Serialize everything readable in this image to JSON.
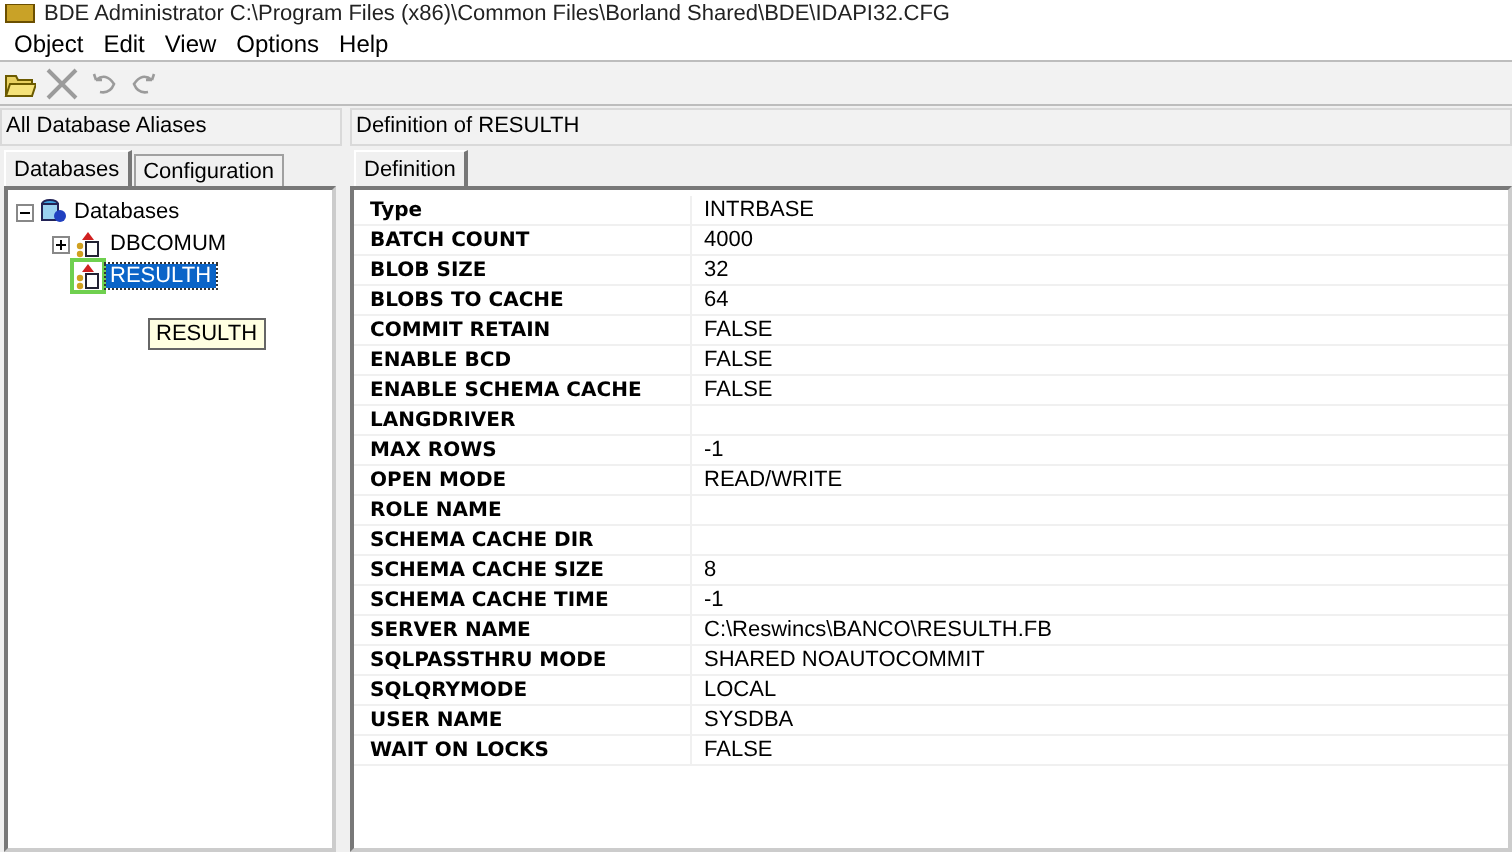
{
  "window": {
    "title": "BDE Administrator  C:\\Program Files (x86)\\Common Files\\Borland Shared\\BDE\\IDAPI32.CFG"
  },
  "menu": [
    "Object",
    "Edit",
    "View",
    "Options",
    "Help"
  ],
  "toolbar": [
    {
      "kind": "open",
      "disabled": false
    },
    {
      "kind": "delete",
      "disabled": true
    },
    {
      "kind": "undo",
      "disabled": true
    },
    {
      "kind": "redo",
      "disabled": true
    }
  ],
  "left": {
    "header": "All Database Aliases",
    "tabs": [
      {
        "label": "Databases",
        "selected": true
      },
      {
        "label": "Configuration",
        "selected": false
      }
    ],
    "tree": [
      {
        "label": "Databases",
        "kind": "root",
        "expanded": true,
        "selected": false,
        "children": [
          {
            "label": "DBCOMUM",
            "kind": "alias",
            "expanded": false,
            "selected": false
          },
          {
            "label": "RESULTH",
            "kind": "alias",
            "selected": true
          }
        ]
      }
    ],
    "tooltip": "RESULTH"
  },
  "right": {
    "header": "Definition of RESULTH",
    "tabs": [
      {
        "label": "Definition",
        "selected": true
      }
    ],
    "rows": [
      {
        "name": "Type",
        "value": "INTRBASE"
      },
      {
        "name": "BATCH COUNT",
        "value": "4000"
      },
      {
        "name": "BLOB SIZE",
        "value": "32"
      },
      {
        "name": "BLOBS TO CACHE",
        "value": "64"
      },
      {
        "name": "COMMIT RETAIN",
        "value": "FALSE"
      },
      {
        "name": "ENABLE BCD",
        "value": "FALSE"
      },
      {
        "name": "ENABLE SCHEMA CACHE",
        "value": "FALSE"
      },
      {
        "name": "LANGDRIVER"
      },
      {
        "name": "MAX ROWS",
        "value": "-1"
      },
      {
        "name": "OPEN MODE",
        "value": "READ/WRITE"
      },
      {
        "name": "ROLE NAME"
      },
      {
        "name": "SCHEMA CACHE DIR"
      },
      {
        "name": "SCHEMA CACHE SIZE",
        "value": "8"
      },
      {
        "name": "SCHEMA CACHE TIME",
        "value": "-1"
      },
      {
        "name": "SERVER NAME",
        "value": "C:\\Reswincs\\BANCO\\RESULTH.FB"
      },
      {
        "name": "SQLPASSTHRU MODE",
        "value": "SHARED NOAUTOCOMMIT"
      },
      {
        "name": "SQLQRYMODE",
        "value": "LOCAL"
      },
      {
        "name": "USER NAME",
        "value": "SYSDBA"
      },
      {
        "name": "WAIT ON LOCKS",
        "value": "FALSE"
      }
    ]
  }
}
